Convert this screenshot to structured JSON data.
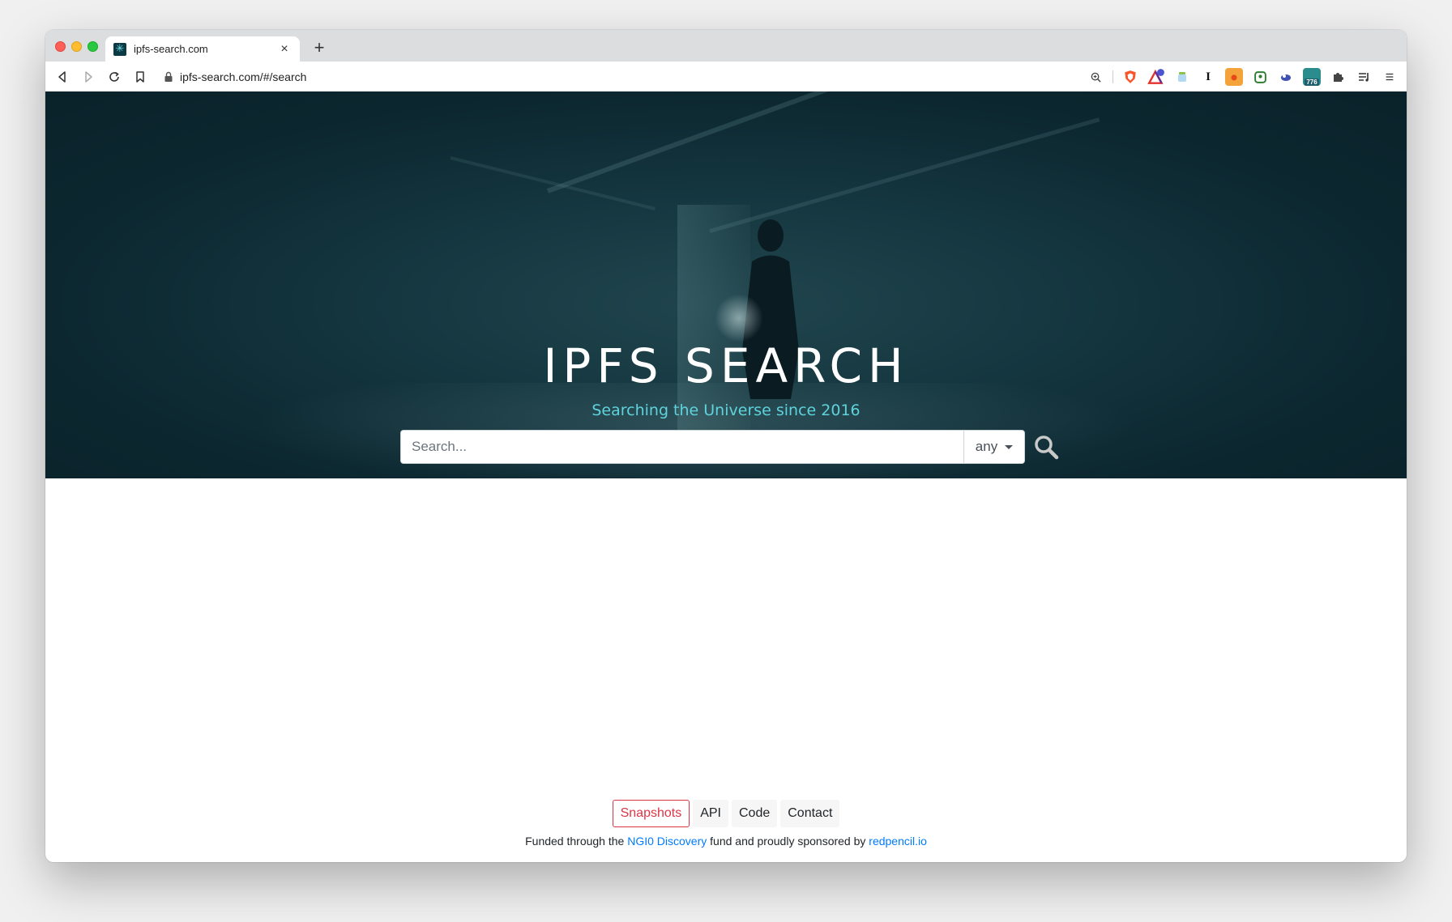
{
  "browser": {
    "tab_title": "ipfs-search.com",
    "url": "ipfs-search.com/#/search",
    "extensions": [
      "zoom-icon",
      "brave-shield-icon",
      "brave-rewards-icon",
      "extension-jar-icon",
      "instapaper-icon",
      "extension-orange-icon",
      "extension-green-icon",
      "extension-cloud-icon",
      "extension-badge-icon",
      "puzzle-icon",
      "reading-list-icon",
      "menu-icon"
    ],
    "extension_badge": "776"
  },
  "hero": {
    "title": "IPFS SEARCH",
    "subtitle": "Searching the Universe since 2016"
  },
  "search": {
    "placeholder": "Search...",
    "type_value": "any"
  },
  "footer": {
    "links": [
      "Snapshots",
      "API",
      "Code",
      "Contact"
    ],
    "funded_prefix": "Funded through the ",
    "ngi_link": "NGI0 Discovery",
    "funded_middle": " fund and proudly sponsored by ",
    "sponsor_link": "redpencil.io"
  },
  "colors": {
    "hero_bg": "#0c2730",
    "subtitle": "#5fd3dc",
    "active_link": "#dc3545",
    "link": "#007bff"
  }
}
